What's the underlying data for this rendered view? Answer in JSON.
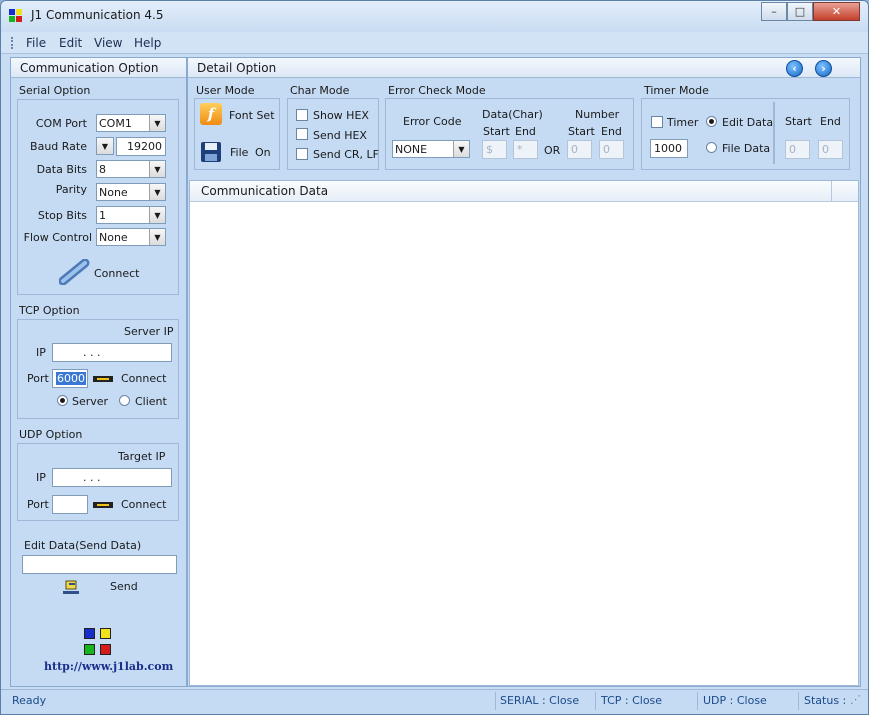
{
  "window": {
    "title": "J1 Communication 4.5",
    "controls": {
      "minimize": "–",
      "maximize": "□",
      "close": "✕"
    }
  },
  "menu": [
    "File",
    "Edit",
    "View",
    "Help"
  ],
  "left": {
    "header": "Communication Option",
    "serial": {
      "title": "Serial Option",
      "com_port_label": "COM Port",
      "com_port_value": "COM1",
      "baud_rate_label": "Baud Rate",
      "baud_rate_value": "19200",
      "data_bits_label": "Data Bits",
      "data_bits_value": "8",
      "parity_label": "Parity",
      "parity_value": "None",
      "stop_bits_label": "Stop Bits",
      "stop_bits_value": "1",
      "flow_label": "Flow Control",
      "flow_value": "None",
      "connect": "Connect"
    },
    "tcp": {
      "title": "TCP Option",
      "server_ip_label": "Server IP",
      "ip_label": "IP",
      "ip_value": ".      .      .",
      "port_label": "Port",
      "port_value": "6000",
      "connect": "Connect",
      "server": "Server",
      "client": "Client",
      "mode_selected": "Server"
    },
    "udp": {
      "title": "UDP Option",
      "target_ip_label": "Target IP",
      "ip_label": "IP",
      "ip_value": ".      .      .",
      "port_label": "Port",
      "port_value": "",
      "connect": "Connect"
    },
    "edit": {
      "title": "Edit Data(Send Data)",
      "value": "",
      "send": "Send"
    },
    "url": "http://www.j1lab.com"
  },
  "detail": {
    "header": "Detail Option",
    "user_mode": {
      "title": "User Mode",
      "font_set": "Font Set",
      "file": "File",
      "file_state": "On"
    },
    "char_mode": {
      "title": "Char Mode",
      "show_hex": "Show HEX",
      "send_hex": "Send HEX",
      "send_crlf": "Send CR, LF"
    },
    "error_mode": {
      "title": "Error Check Mode",
      "error_code_label": "Error Code",
      "error_code_value": "NONE",
      "data_char_label": "Data(Char)",
      "number_label": "Number",
      "start": "Start",
      "end": "End",
      "or": "OR",
      "data_start": "$",
      "data_end": "*",
      "num_start": "0",
      "num_end": "0"
    },
    "timer_mode": {
      "title": "Timer Mode",
      "timer": "Timer",
      "timer_value": "1000",
      "edit_data": "Edit Data",
      "file_data": "File Data",
      "start": "Start",
      "end": "End",
      "start_value": "0",
      "end_value": "0"
    }
  },
  "comm": {
    "header": "Communication Data"
  },
  "status": {
    "ready": "Ready",
    "serial": "SERIAL : Close",
    "tcp": "TCP : Close",
    "udp": "UDP : Close",
    "status": "Status :"
  },
  "colors": {
    "accent": "#1b4a8a",
    "panel": "#c5dbf4",
    "close": "#c4402b"
  }
}
